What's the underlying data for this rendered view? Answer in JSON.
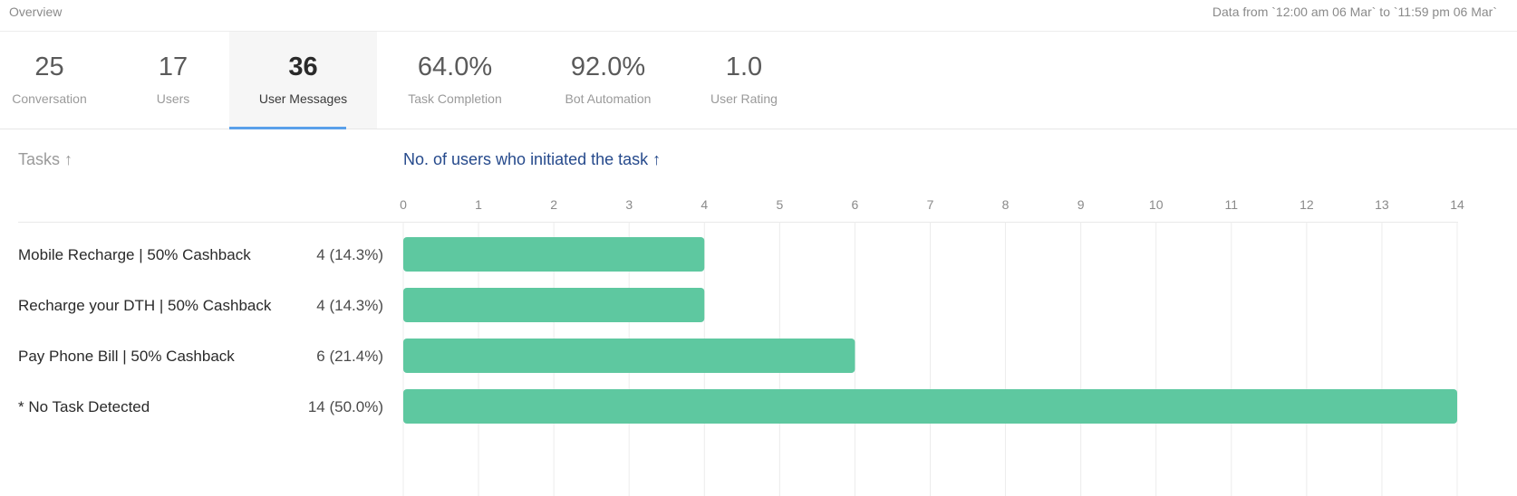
{
  "header": {
    "overview_label": "Overview",
    "date_range": "Data from `12:00 am 06 Mar` to `11:59 pm 06 Mar`"
  },
  "metrics": [
    {
      "value": "25",
      "label": "Conversation",
      "active": false
    },
    {
      "value": "17",
      "label": "Users",
      "active": false
    },
    {
      "value": "36",
      "label": "User Messages",
      "active": true
    },
    {
      "value": "64.0%",
      "label": "Task Completion",
      "active": false
    },
    {
      "value": "92.0%",
      "label": "Bot Automation",
      "active": false
    },
    {
      "value": "1.0",
      "label": "User Rating",
      "active": false
    }
  ],
  "table": {
    "tasks_header": "Tasks ↑",
    "count_header": "No. of users who initiated the task ↑",
    "rows": [
      {
        "name": "Mobile Recharge | 50% Cashback",
        "count": "4 (14.3%)"
      },
      {
        "name": "Recharge your DTH | 50% Cashback",
        "count": "4 (14.3%)"
      },
      {
        "name": "Pay Phone Bill | 50% Cashback",
        "count": "6 (21.4%)"
      },
      {
        "name": "* No Task Detected",
        "count": "14 (50.0%)"
      }
    ]
  },
  "colors": {
    "bar": "#5ec8a0",
    "grid": "#ececec",
    "active_tab_indicator": "#5aa0ea",
    "sort_header_active": "#264a8c"
  },
  "chart_data": {
    "type": "bar",
    "orientation": "horizontal",
    "categories": [
      "Mobile Recharge | 50% Cashback",
      "Recharge your DTH | 50% Cashback",
      "Pay Phone Bill | 50% Cashback",
      "* No Task Detected"
    ],
    "values": [
      4,
      4,
      6,
      14
    ],
    "xlim": [
      0,
      14
    ],
    "xticks": [
      0,
      1,
      2,
      3,
      4,
      5,
      6,
      7,
      8,
      9,
      10,
      11,
      12,
      13,
      14
    ],
    "grid": true
  }
}
